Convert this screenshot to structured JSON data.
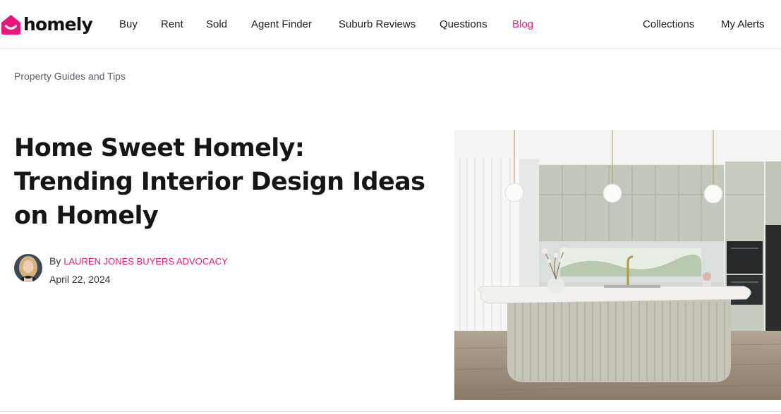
{
  "brand": {
    "name": "homely",
    "color": "#e8187b"
  },
  "nav": {
    "buy": "Buy",
    "rent": "Rent",
    "sold": "Sold",
    "agent_finder": "Agent Finder",
    "suburb_reviews": "Suburb Reviews",
    "questions": "Questions",
    "blog": "Blog",
    "collections": "Collections",
    "my_alerts": "My Alerts",
    "active": "Blog"
  },
  "breadcrumb": "Property Guides and Tips",
  "article": {
    "title": "Home Sweet Homely: Trending Interior Design Ideas on Homely",
    "by_label": "By",
    "author": "LAUREN JONES BUYERS ADVOCACY",
    "date": "April 22, 2024"
  },
  "icons": {
    "logo": "homely-house-smile-icon",
    "avatar": "author-avatar"
  }
}
